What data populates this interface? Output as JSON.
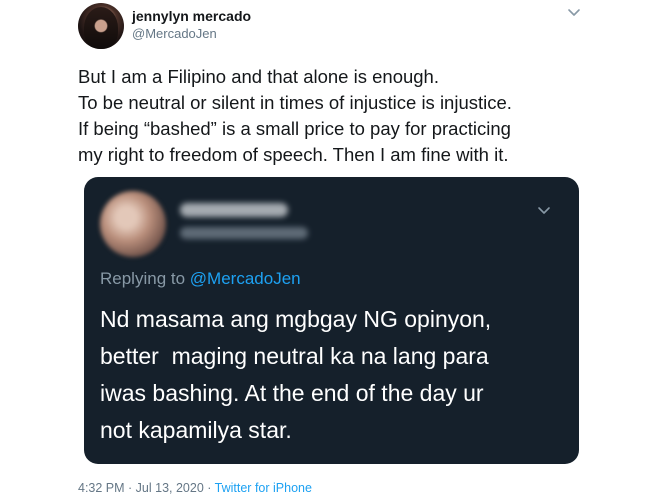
{
  "author": {
    "display_name": "jennylyn mercado",
    "handle": "@MercadoJen",
    "avatar_icon": "profile-photo"
  },
  "tweet": {
    "lines": [
      "But I am a Filipino and that alone is enough.",
      "To be neutral or silent in times of injustice is injustice.",
      "If being “bashed” is a small price to pay for practicing",
      "my right to freedom of speech. Then I am fine with it."
    ]
  },
  "quoted_tweet": {
    "author_name_blurred": true,
    "replying_label": "Replying to",
    "replying_to": "@MercadoJen",
    "lines": [
      "Nd masama ang mgbgay NG opinyon,",
      "better  maging neutral ka na lang para",
      "iwas bashing. At the end of the day ur",
      "not kapamilya star."
    ],
    "background_color": "#15202b"
  },
  "meta": {
    "timestamp": "4:32 PM · Jul 13, 2020 · ",
    "source": "Twitter for iPhone"
  },
  "colors": {
    "accent": "#1da1f2",
    "text": "#14171a",
    "muted": "#657786"
  }
}
